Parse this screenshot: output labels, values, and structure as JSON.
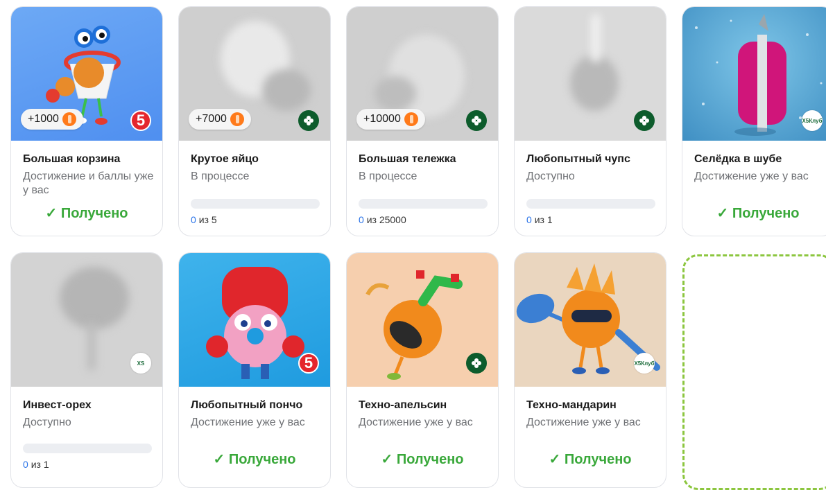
{
  "received_label": "Получено",
  "cards": [
    {
      "title": "Большая корзина",
      "subtitle": "Достижение и баллы уже у вас",
      "points": "+1000",
      "badge": "5",
      "status": "received",
      "image": "blue",
      "icon": "basketball-hoop-character"
    },
    {
      "title": "Крутое яйцо",
      "subtitle": "В процессе",
      "points": "+7000",
      "badge": "perekrestok",
      "status": "progress",
      "progress_current": "0",
      "progress_total": "из 5",
      "image": "blurred",
      "progress": 0
    },
    {
      "title": "Большая тележка",
      "subtitle": "В процессе",
      "points": "+10000",
      "badge": "perekrestok",
      "status": "progress",
      "progress_current": "0",
      "progress_total": "из 25000",
      "image": "blurred",
      "progress": 0
    },
    {
      "title": "Любопытный чупс",
      "subtitle": "Доступно",
      "badge": "perekrestok",
      "status": "progress",
      "progress_current": "0",
      "progress_total": "из 1",
      "image": "blurred",
      "progress": 0
    },
    {
      "title": "Селёдка в шубе",
      "subtitle": "Достижение уже у вас",
      "badge": "x5club",
      "status": "received",
      "image": "snow",
      "icon": "herring-in-fur-coat-character"
    },
    {
      "title": "Инвест-орех",
      "subtitle": "Доступно",
      "badge": "xs",
      "status": "progress",
      "progress_current": "0",
      "progress_total": "из 1",
      "image": "blurred",
      "progress": 0
    },
    {
      "title": "Любопытный пончо",
      "subtitle": "Достижение уже у вас",
      "badge": "5",
      "status": "received",
      "image": "cyan",
      "icon": "donut-boxer-character"
    },
    {
      "title": "Техно-апельсин",
      "subtitle": "Достижение уже у вас",
      "badge": "perekrestok",
      "status": "received",
      "image": "peach",
      "icon": "breakdancing-orange-character"
    },
    {
      "title": "Техно-мандарин",
      "subtitle": "Достижение уже у вас",
      "badge": "x5club",
      "status": "received",
      "image": "beige",
      "icon": "mandarin-paddle-character"
    }
  ],
  "badges": {
    "5": "5",
    "xs": "XS",
    "x5club": "X5Клуб"
  },
  "colors": {
    "accent_green": "#39a83a",
    "progress_blue": "#2a73e8",
    "coin_orange": "#ff7a1a",
    "perekrestok_green": "#0d5c2c",
    "pyaterochka_red": "#e4262d",
    "placeholder_border": "#8cc63f"
  }
}
